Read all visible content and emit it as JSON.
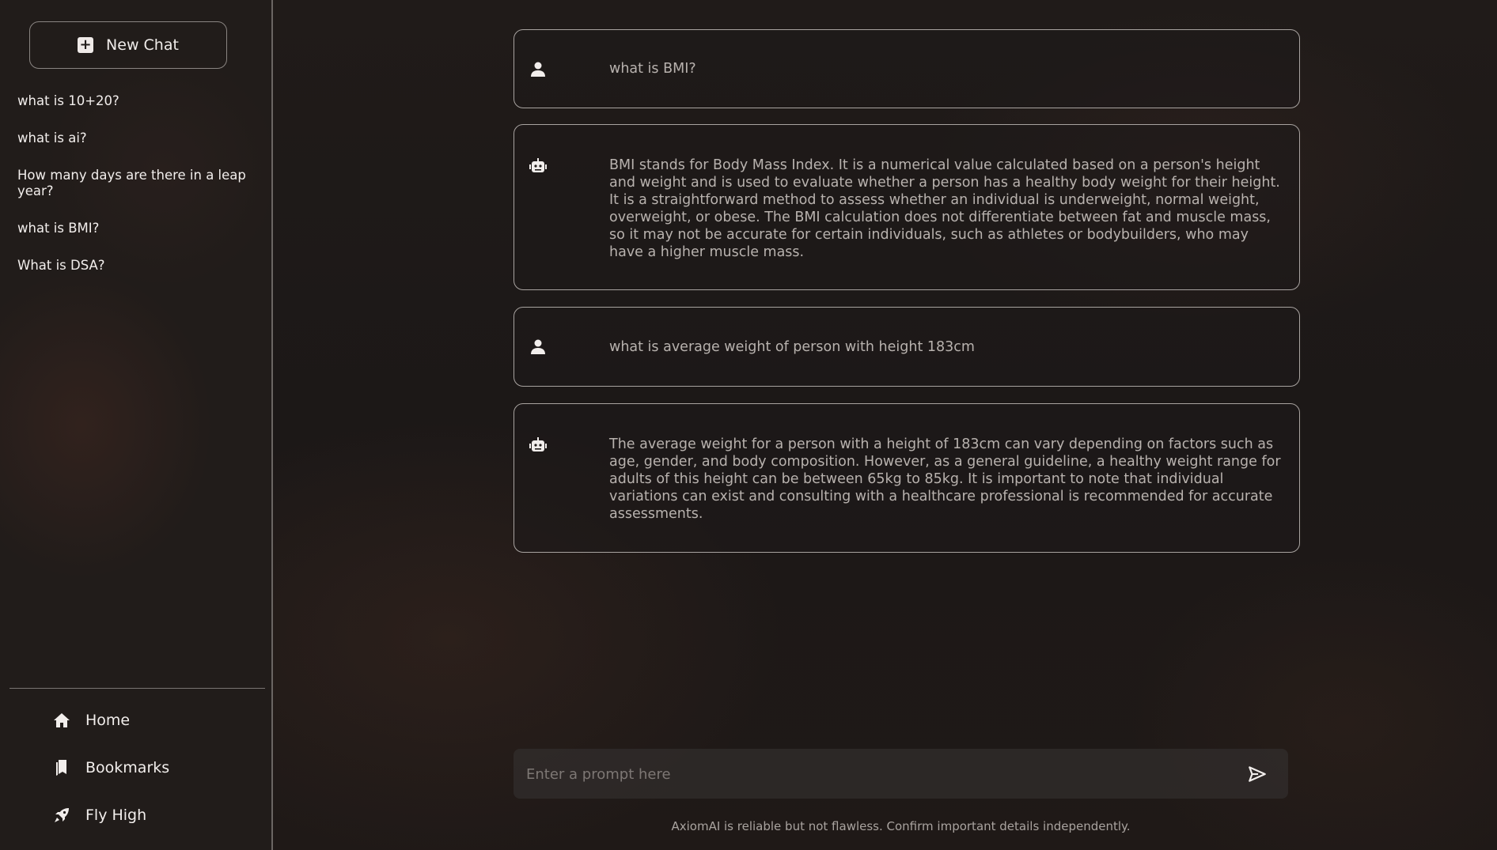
{
  "sidebar": {
    "new_chat_label": "New Chat",
    "history": [
      "what is 10+20?",
      "what is ai?",
      "How many days are there in a leap year?",
      "what is BMI?",
      "What is DSA?"
    ],
    "nav": {
      "home": "Home",
      "bookmarks": "Bookmarks",
      "fly_high": "Fly High"
    }
  },
  "messages": [
    {
      "role": "user",
      "icon": "user-icon",
      "text": "what is BMI?"
    },
    {
      "role": "bot",
      "icon": "robot-icon",
      "text": "BMI stands for Body Mass Index. It is a numerical value calculated based on a person's height and weight and is used to evaluate whether a person has a healthy body weight for their height. It is a straightforward method to assess whether an individual is underweight, normal weight, overweight, or obese. The BMI calculation does not differentiate between fat and muscle mass, so it may not be accurate for certain individuals, such as athletes or bodybuilders, who may have a higher muscle mass."
    },
    {
      "role": "user",
      "icon": "user-icon",
      "text": "what is average weight of person with height 183cm"
    },
    {
      "role": "bot",
      "icon": "robot-icon",
      "text": "The average weight for a person with a height of 183cm can vary depending on factors such as age, gender, and body composition. However, as a general guideline, a healthy weight range for adults of this height can be between 65kg to 85kg. It is important to note that individual variations can exist and consulting with a healthcare professional is recommended for accurate assessments."
    }
  ],
  "prompt": {
    "placeholder": "Enter a prompt here",
    "value": ""
  },
  "disclaimer": "AxiomAI is reliable but not flawless. Confirm important details independently."
}
